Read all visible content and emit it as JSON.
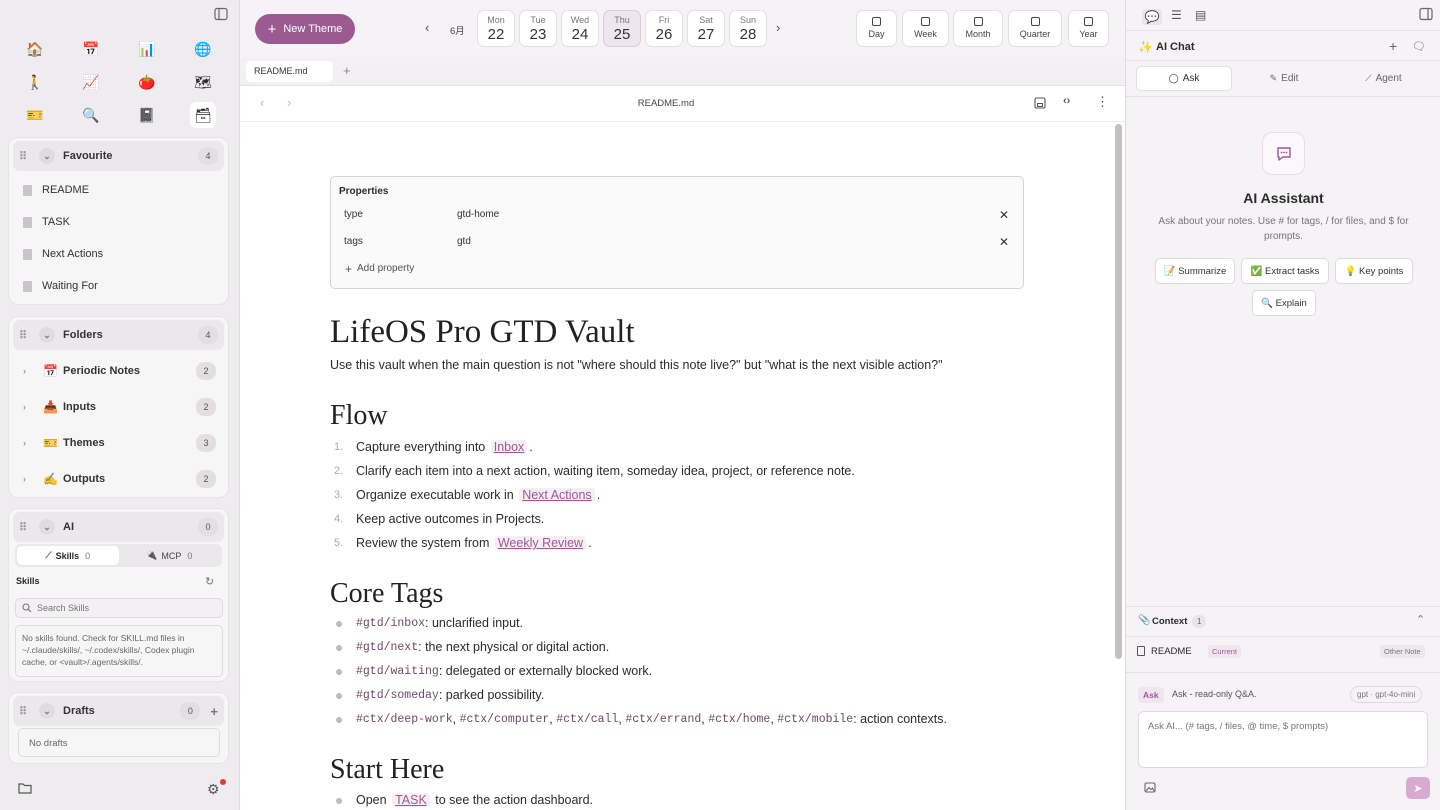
{
  "sidebar": {
    "ribbon": [
      {
        "icon": "home-icon",
        "glyph": "🏠"
      },
      {
        "icon": "calendar-icon",
        "glyph": "📅"
      },
      {
        "icon": "bar-chart-icon",
        "glyph": "📊"
      },
      {
        "icon": "globe-icon",
        "glyph": "🌐"
      },
      {
        "icon": "walking-icon",
        "glyph": "🚶"
      },
      {
        "icon": "trend-chart-icon",
        "glyph": "📈"
      },
      {
        "icon": "tomato-icon",
        "glyph": "🍅"
      },
      {
        "icon": "map-icon",
        "glyph": "🗺"
      },
      {
        "icon": "ticket-icon",
        "glyph": "🎫"
      },
      {
        "icon": "search-icon",
        "glyph": "🔍"
      },
      {
        "icon": "notebook-icon",
        "glyph": "📓"
      },
      {
        "icon": "card-box-icon",
        "glyph": "🗃"
      }
    ],
    "favourite": {
      "title": "Favourite",
      "count": "4",
      "items": [
        "README",
        "TASK",
        "Next Actions",
        "Waiting For"
      ]
    },
    "folders": {
      "title": "Folders",
      "count": "4",
      "items": [
        {
          "emoji": "📅",
          "label": "Periodic Notes",
          "count": "2"
        },
        {
          "emoji": "📥",
          "label": "Inputs",
          "count": "2"
        },
        {
          "emoji": "🎫",
          "label": "Themes",
          "count": "3"
        },
        {
          "emoji": "✍️",
          "label": "Outputs",
          "count": "2"
        }
      ]
    },
    "ai": {
      "title": "AI",
      "count": "0",
      "skills_tab": "Skills",
      "skills_count": "0",
      "mcp_tab": "MCP",
      "mcp_count": "0",
      "skills_heading": "Skills",
      "search_placeholder": "Search Skills",
      "empty_msg": "No skills found. Check for SKILL.md files in ~/.claude/skills/, ~/.codex/skills/, Codex plugin cache, or <vault>/.agents/skills/."
    },
    "drafts": {
      "title": "Drafts",
      "count": "0",
      "empty": "No drafts"
    }
  },
  "topbar": {
    "new_theme": "New Theme",
    "month": "6月",
    "days": [
      {
        "name": "Mon",
        "num": "22"
      },
      {
        "name": "Tue",
        "num": "23"
      },
      {
        "name": "Wed",
        "num": "24"
      },
      {
        "name": "Thu",
        "num": "25",
        "active": true
      },
      {
        "name": "Fri",
        "num": "26"
      },
      {
        "name": "Sat",
        "num": "27"
      },
      {
        "name": "Sun",
        "num": "28"
      }
    ],
    "periods": [
      "Day",
      "Week",
      "Month",
      "Quarter",
      "Year"
    ]
  },
  "tab": {
    "name": "README.md"
  },
  "editor": {
    "title": "README.md",
    "properties": {
      "heading": "Properties",
      "rows": [
        {
          "key": "type",
          "value": "gtd-home"
        },
        {
          "key": "tags",
          "value": "gtd"
        }
      ],
      "add": "Add property"
    },
    "h1": "LifeOS Pro GTD Vault",
    "intro": "Use this vault when the main question is not \"where should this note live?\" but \"what is the next visible action?\"",
    "flow_heading": "Flow",
    "flow": [
      {
        "n": "1.",
        "pre": "Capture everything into ",
        "link": "Inbox",
        "post": "."
      },
      {
        "n": "2.",
        "pre": "Clarify each item into a next action, waiting item, someday idea, project, or reference note.",
        "link": "",
        "post": ""
      },
      {
        "n": "3.",
        "pre": "Organize executable work in ",
        "link": "Next Actions",
        "post": "."
      },
      {
        "n": "4.",
        "pre": "Keep active outcomes in Projects.",
        "link": "",
        "post": ""
      },
      {
        "n": "5.",
        "pre": "Review the system from ",
        "link": "Weekly Review",
        "post": "."
      }
    ],
    "tags_heading": "Core Tags",
    "tags": [
      {
        "tag": "#gtd/inbox",
        "text": ": unclarified input."
      },
      {
        "tag": "#gtd/next",
        "text": ": the next physical or digital action."
      },
      {
        "tag": "#gtd/waiting",
        "text": ": delegated or externally blocked work."
      },
      {
        "tag": "#gtd/someday",
        "text": ": parked possibility."
      }
    ],
    "ctx_tags": [
      "#ctx/deep-work",
      "#ctx/computer",
      "#ctx/call",
      "#ctx/errand",
      "#ctx/home",
      "#ctx/mobile"
    ],
    "ctx_text": ": action contexts.",
    "start_heading": "Start Here",
    "start": {
      "pre": "Open ",
      "link": "TASK",
      "post": " to see the action dashboard."
    }
  },
  "right": {
    "title": "AI Chat",
    "tabs": [
      "Ask",
      "Edit",
      "Agent"
    ],
    "assistant_title": "AI Assistant",
    "assistant_desc": "Ask about your notes. Use # for tags, / for files, and $ for prompts.",
    "chips": [
      "📝 Summarize",
      "✅ Extract tasks",
      "💡 Key points",
      "🔍 Explain"
    ],
    "context_label": "Context",
    "context_count": "1",
    "context_note": "README",
    "context_current": "Current",
    "context_other": "Other Note",
    "mode_badge": "Ask",
    "mode_desc": "Ask - read-only Q&A.",
    "model": "gpt · gpt-4o-mini",
    "input_placeholder": "Ask AI... (# tags, / files, @ time, $ prompts)"
  },
  "colors": {
    "accent": "#9c5a93",
    "accent_light": "#efe5ee"
  }
}
